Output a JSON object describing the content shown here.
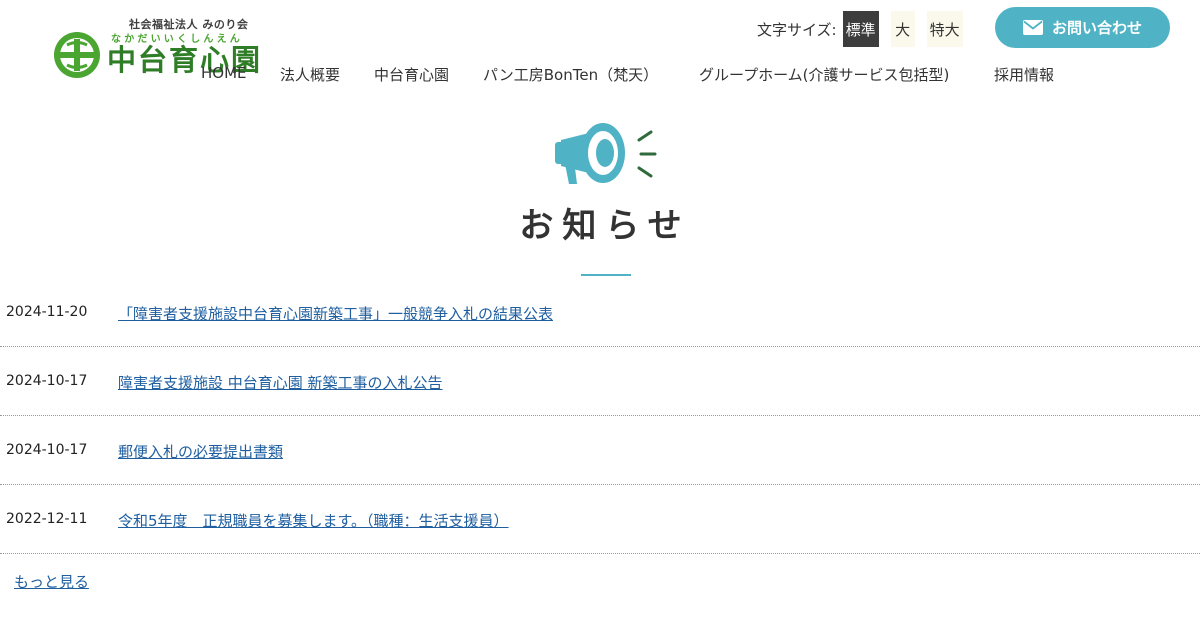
{
  "brand": {
    "org": "社会福祉法人 みのり会",
    "kana": "なかだいいくしんえん",
    "name": "中台育心園",
    "colors": {
      "green": "#2f7e27",
      "accent": "#4fb3c5"
    }
  },
  "fontsize": {
    "label": "文字サイズ:",
    "options": [
      "標準",
      "大",
      "特大"
    ],
    "selected": "標準"
  },
  "contact": {
    "label": "お問い合わせ",
    "icon": "mail-icon"
  },
  "nav": [
    "HOME",
    "法人概要",
    "中台育心園",
    "パン工房BonTen（梵天）",
    "グループホーム(介護サービス包括型)",
    "採用情報"
  ],
  "heading": {
    "title": "お知らせ",
    "icon": "megaphone-icon"
  },
  "news": [
    {
      "date": "2024-11-20",
      "title": "「障害者支援施設中台育心園新築工事」一般競争入札の結果公表"
    },
    {
      "date": "2024-10-17",
      "title": "障害者支援施設 中台育心園 新築工事の入札公告"
    },
    {
      "date": "2024-10-17",
      "title": "郵便入札の必要提出書類"
    },
    {
      "date": "2022-12-11",
      "title": "令和5年度　正規職員を募集します。（職種：生活支援員）"
    }
  ],
  "more": "もっと見る "
}
